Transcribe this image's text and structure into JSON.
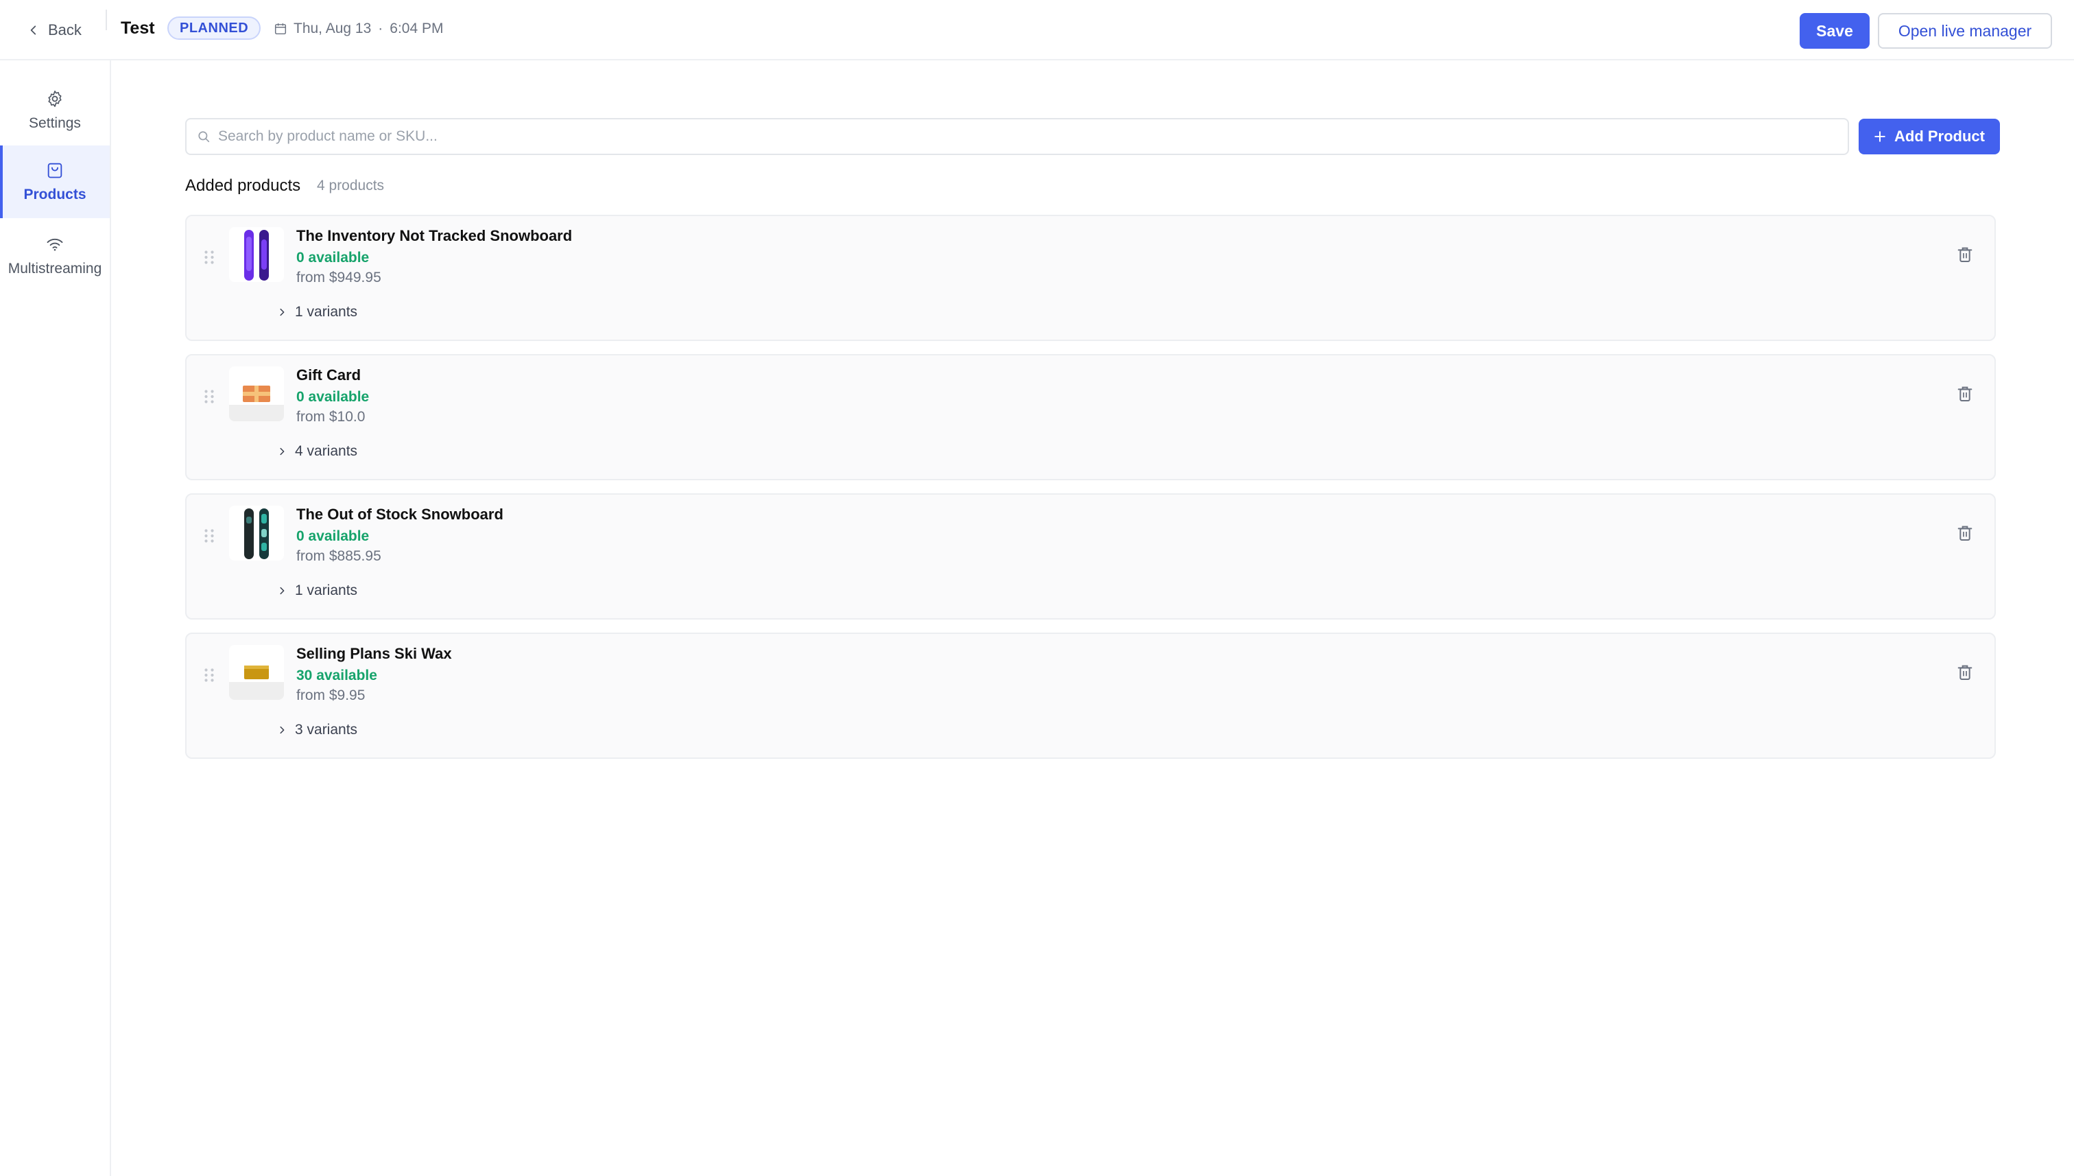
{
  "header": {
    "back_label": "Back",
    "title": "Test",
    "status_badge": "PLANNED",
    "date": "Thu, Aug 13",
    "separator": "·",
    "time": "6:04 PM",
    "save_label": "Save",
    "open_live_label": "Open live manager"
  },
  "sidebar": {
    "items": [
      {
        "label": "Settings",
        "icon": "gear-icon",
        "active": false
      },
      {
        "label": "Products",
        "icon": "shopping-bag-icon",
        "active": true
      },
      {
        "label": "Multistreaming",
        "icon": "wifi-icon",
        "active": false
      }
    ]
  },
  "main": {
    "search_placeholder": "Search by product name or SKU...",
    "search_value": "",
    "add_product_label": "Add Product",
    "section_title": "Added products",
    "section_count": "4 products",
    "products": [
      {
        "name": "The Inventory Not Tracked Snowboard",
        "availability": "0 available",
        "price": "from $949.95",
        "variants": "1 variants",
        "thumb": "snowboard-purple"
      },
      {
        "name": "Gift Card",
        "availability": "0 available",
        "price": "from $10.0",
        "variants": "4 variants",
        "thumb": "gift-card"
      },
      {
        "name": "The Out of Stock Snowboard",
        "availability": "0 available",
        "price": "from $885.95",
        "variants": "1 variants",
        "thumb": "snowboard-dark"
      },
      {
        "name": "Selling Plans Ski Wax",
        "availability": "30 available",
        "price": "from $9.95",
        "variants": "3 variants",
        "thumb": "ski-wax"
      }
    ]
  },
  "colors": {
    "accent": "#4361ee",
    "badge_bg": "#eef2fe",
    "available_green": "#16a36b"
  }
}
